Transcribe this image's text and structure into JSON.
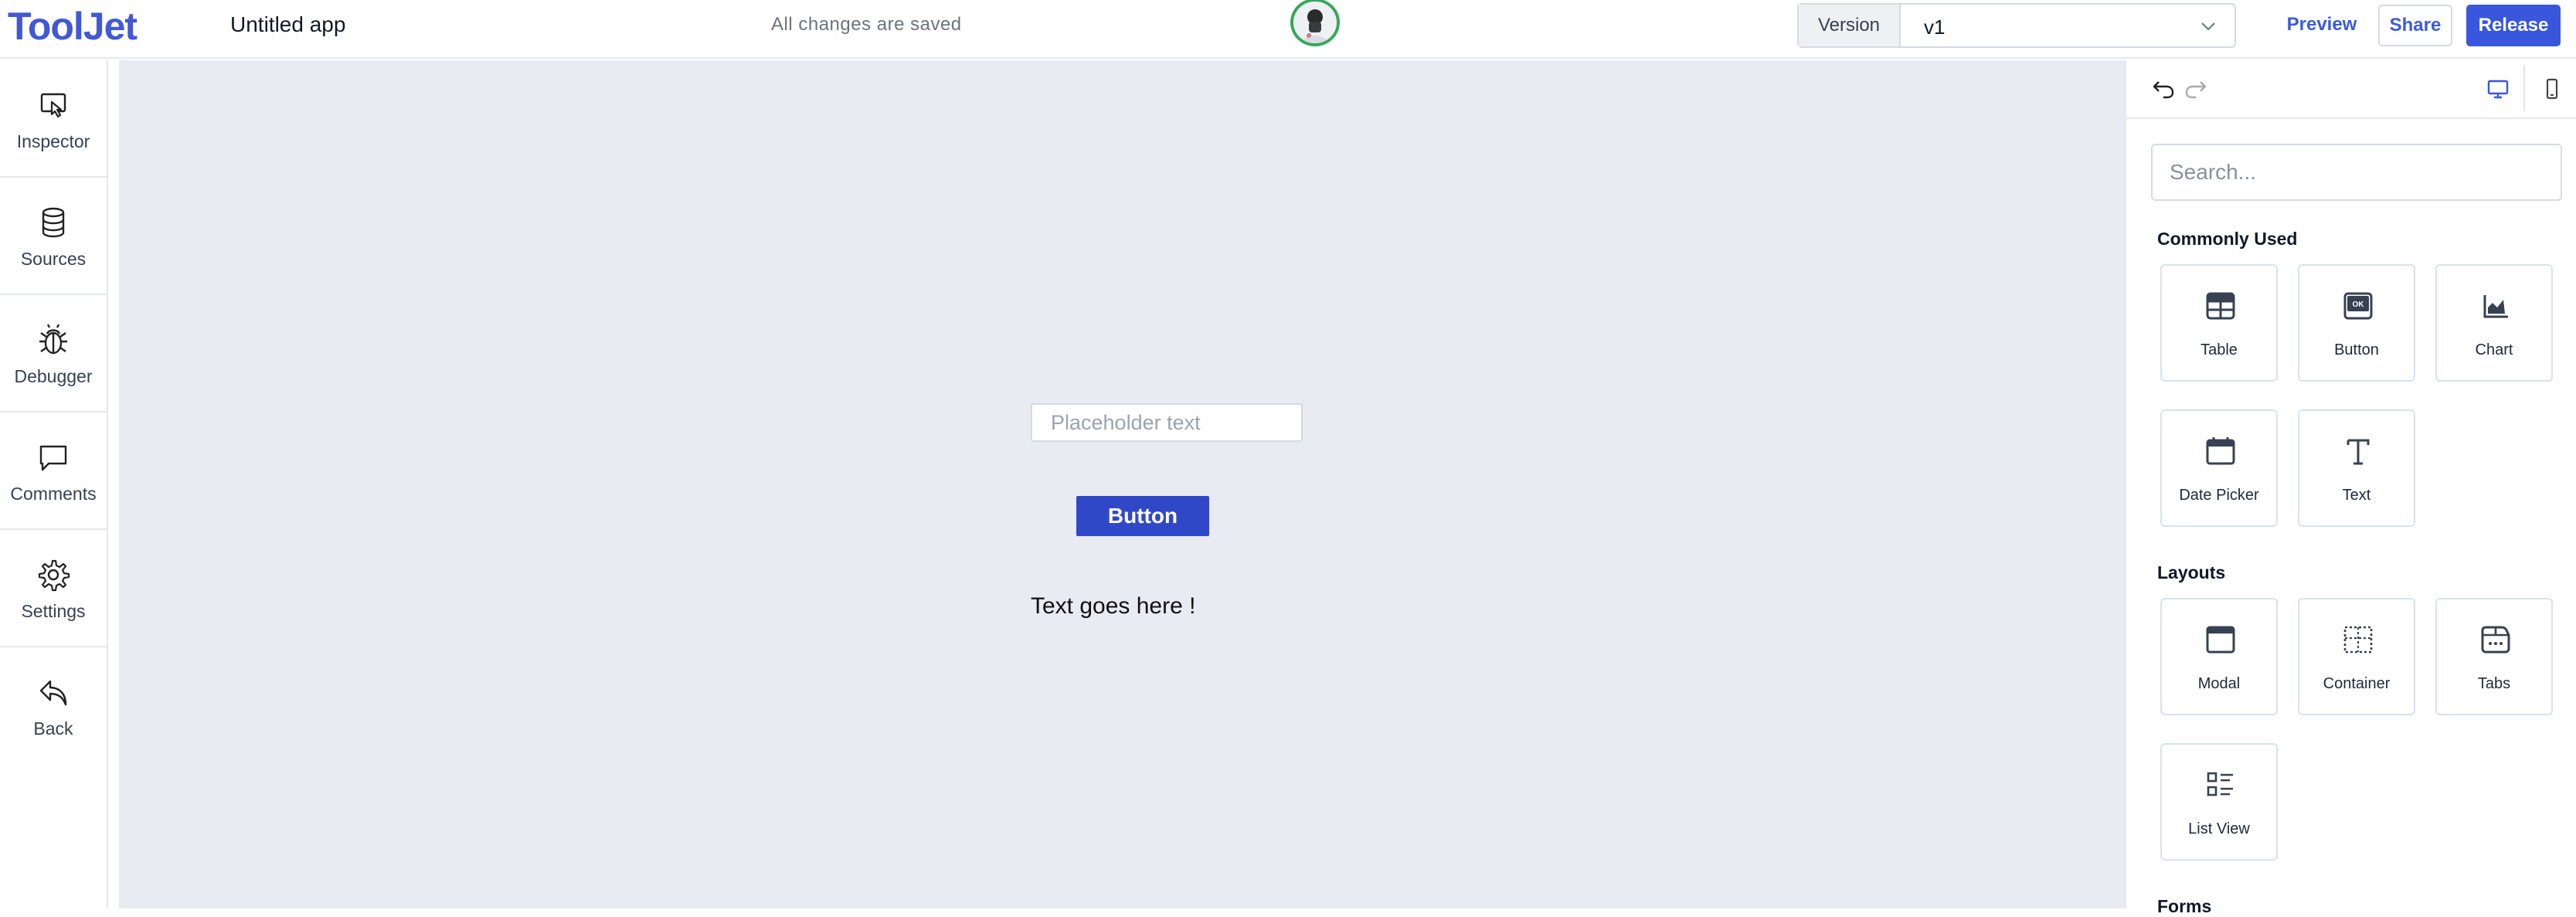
{
  "header": {
    "logo": "ToolJet",
    "app_name": "Untitled app",
    "save_status": "All changes are saved",
    "version_label": "Version",
    "version_value": "v1",
    "preview_label": "Preview",
    "share_label": "Share",
    "release_label": "Release"
  },
  "sidebar": {
    "items": [
      {
        "label": "Inspector",
        "icon": "inspector-icon"
      },
      {
        "label": "Sources",
        "icon": "database-icon"
      },
      {
        "label": "Debugger",
        "icon": "bug-icon"
      },
      {
        "label": "Comments",
        "icon": "comment-icon"
      },
      {
        "label": "Settings",
        "icon": "gear-icon"
      },
      {
        "label": "Back",
        "icon": "back-arrow-icon"
      }
    ]
  },
  "canvas": {
    "input_placeholder": "Placeholder text",
    "button_label": "Button",
    "text_content": "Text goes here !"
  },
  "widget_panel": {
    "search_placeholder": "Search...",
    "sections": [
      {
        "title": "Commonly Used",
        "widgets": [
          {
            "label": "Table",
            "icon": "table-icon"
          },
          {
            "label": "Button",
            "icon": "ok-button-icon"
          },
          {
            "label": "Chart",
            "icon": "chart-icon"
          },
          {
            "label": "Date Picker",
            "icon": "calendar-icon"
          },
          {
            "label": "Text",
            "icon": "text-icon"
          }
        ]
      },
      {
        "title": "Layouts",
        "widgets": [
          {
            "label": "Modal",
            "icon": "modal-icon"
          },
          {
            "label": "Container",
            "icon": "container-icon"
          },
          {
            "label": "Tabs",
            "icon": "tabs-icon"
          },
          {
            "label": "List View",
            "icon": "list-view-icon"
          }
        ]
      },
      {
        "title": "Forms",
        "widgets": []
      }
    ]
  },
  "colors": {
    "brand": "#4258d4",
    "primary_button": "#3957dd",
    "canvas_bg": "#e8ebf2"
  }
}
